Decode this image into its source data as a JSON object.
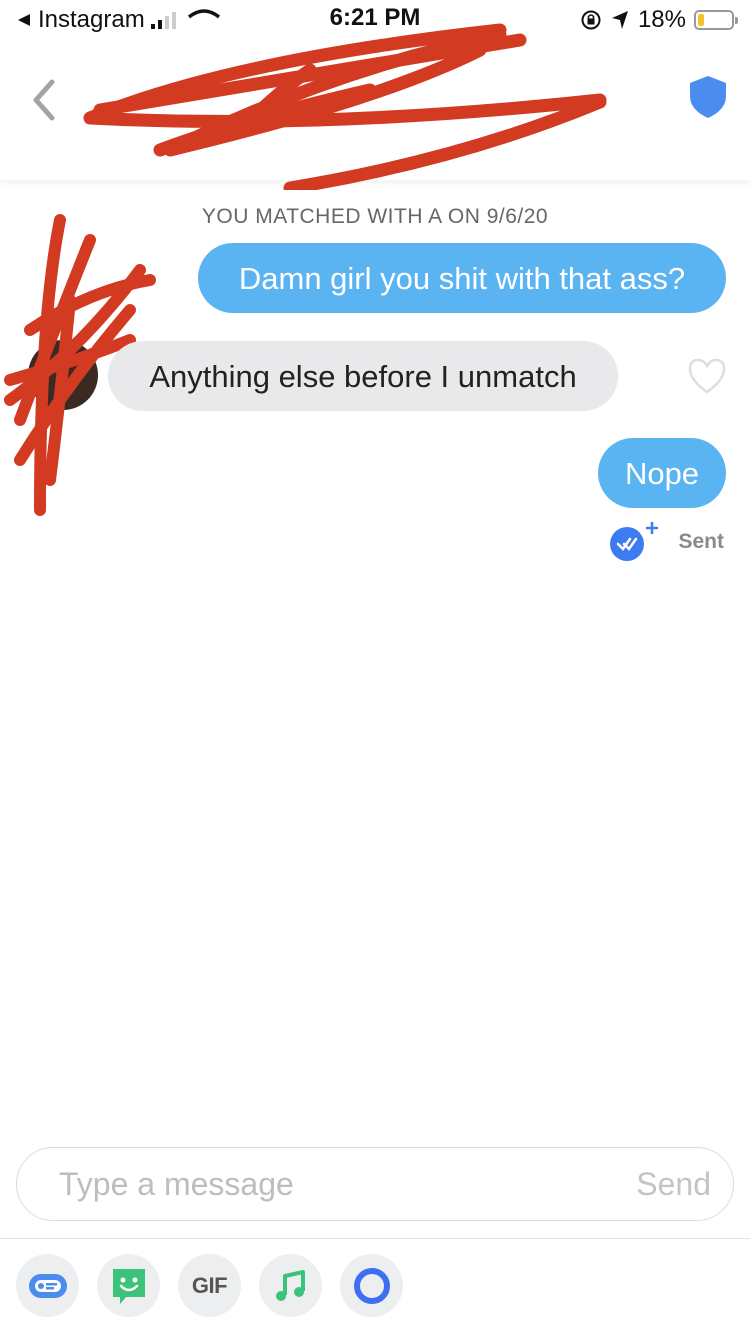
{
  "status_bar": {
    "back_app": "Instagram",
    "time": "6:21 PM",
    "battery_percent": "18%",
    "battery_level": 0.18
  },
  "header": {
    "back_icon": "chevron-left-icon",
    "safety_icon": "shield-icon"
  },
  "conversation": {
    "match_text": "YOU MATCHED WITH          A ON 9/6/20",
    "messages": [
      {
        "direction": "outgoing",
        "text": "Damn girl you shit with that ass?"
      },
      {
        "direction": "incoming",
        "text": "Anything else before I unmatch"
      },
      {
        "direction": "outgoing",
        "text": "Nope"
      }
    ],
    "status_label": "Sent"
  },
  "composer": {
    "placeholder": "Type a message",
    "send_label": "Send"
  },
  "toolbar": {
    "gif_label": "GIF",
    "items": [
      "contact-card-icon",
      "sticker-icon",
      "gif-icon",
      "music-icon",
      "circle-icon"
    ]
  },
  "colors": {
    "outgoing_bubble": "#5ab4f2",
    "incoming_bubble": "#e9e9eb",
    "accent_blue": "#3d7cf0",
    "redaction": "#d23a22"
  }
}
